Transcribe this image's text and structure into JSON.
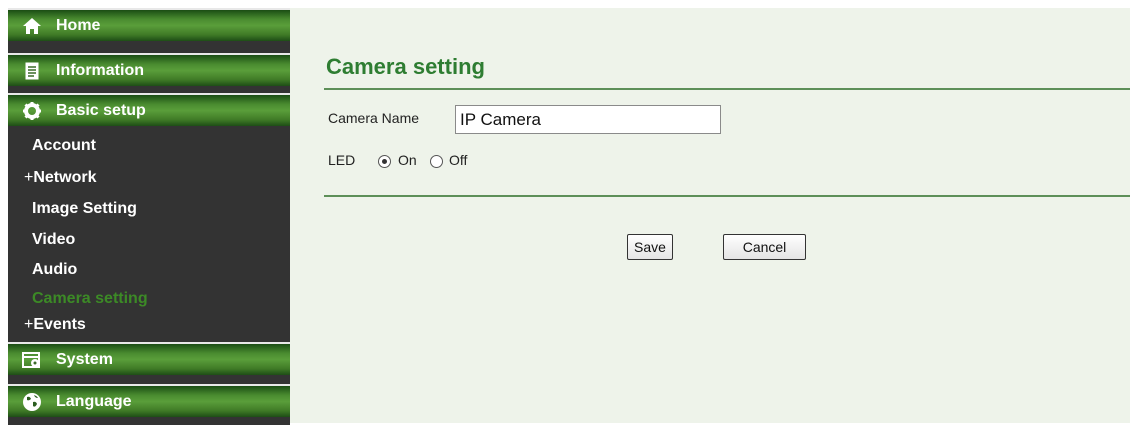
{
  "sidebar": {
    "home": {
      "label": "Home",
      "icon": "home-icon"
    },
    "information": {
      "label": "Information",
      "icon": "document-icon"
    },
    "basic_setup": {
      "label": "Basic setup",
      "icon": "gear-icon"
    },
    "sub_items": [
      {
        "label": "Account"
      },
      {
        "label": "Network",
        "prefix": "+"
      },
      {
        "label": "Image Setting"
      },
      {
        "label": "Video"
      },
      {
        "label": "Audio"
      },
      {
        "label": "Camera setting",
        "active": true
      },
      {
        "label": "Events",
        "prefix": "+"
      }
    ],
    "system": {
      "label": "System",
      "icon": "window-gear-icon"
    },
    "language": {
      "label": "Language",
      "icon": "globe-icon"
    }
  },
  "main": {
    "title": "Camera setting",
    "camera_name_label": "Camera Name",
    "camera_name_value": "IP Camera",
    "led_label": "LED",
    "led_on_label": "On",
    "led_off_label": "Off",
    "led_selected": "On",
    "save_label": "Save",
    "cancel_label": "Cancel"
  },
  "colors": {
    "accent_green": "#2e7d32",
    "active_menu_text": "#3c8a26",
    "sidebar_bg": "#333333",
    "content_bg": "#eef3ea"
  }
}
